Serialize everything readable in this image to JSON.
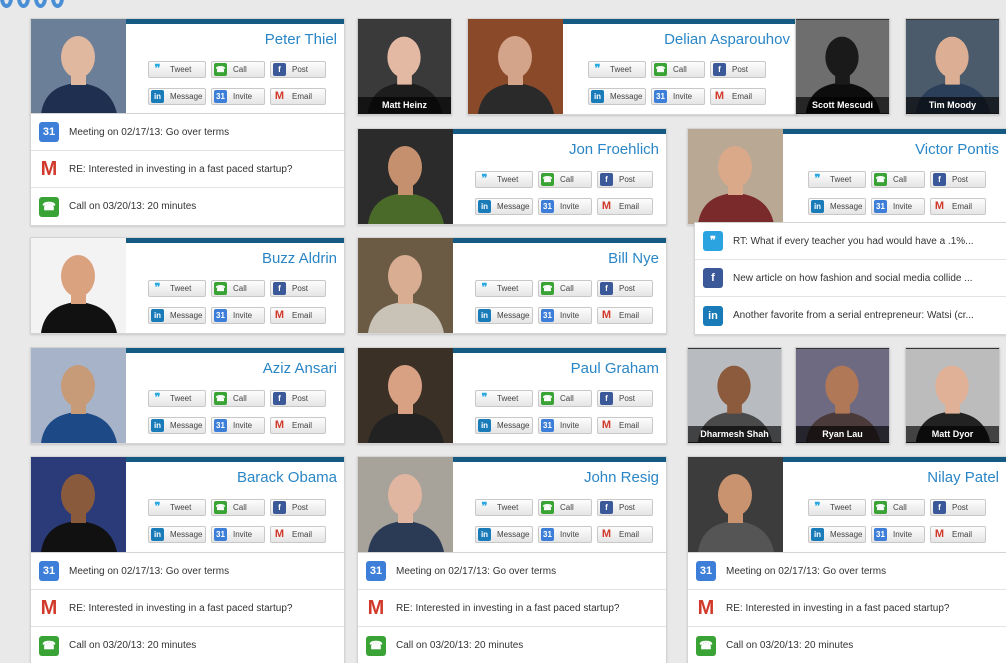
{
  "buttons": {
    "tweet": "Tweet",
    "call": "Call",
    "post": "Post",
    "message": "Message",
    "invite": "Invite",
    "email": "Email"
  },
  "icons": {
    "tweet": "twitter-bird-icon",
    "call": "phone-icon",
    "post": "facebook-icon",
    "message": "linkedin-icon",
    "invite": "calendar-icon",
    "email": "gmail-icon"
  },
  "calendar_glyph": "31",
  "contacts": [
    {
      "name": "Peter Thiel",
      "photo": {
        "bg": "#6b7f99",
        "skin": "#e0b8a0",
        "shirt": "#1f2f4f"
      }
    },
    {
      "name": "Delian Asparouhov",
      "photo": {
        "bg": "#8a4a2a",
        "skin": "#d4a48a",
        "shirt": "#2a2a2a"
      }
    },
    {
      "name": "Jon Froehlich",
      "photo": {
        "bg": "#2b2b2b",
        "skin": "#c4906e",
        "shirt": "#4a6a2a"
      }
    },
    {
      "name": "Victor Pontis",
      "photo": {
        "bg": "#b9a994",
        "skin": "#d9a98a",
        "shirt": "#7a2a2a"
      }
    },
    {
      "name": "Buzz Aldrin",
      "photo": {
        "bg": "#f3f3f3",
        "skin": "#dba27f",
        "shirt": "#111111"
      }
    },
    {
      "name": "Bill Nye",
      "photo": {
        "bg": "#6b5a44",
        "skin": "#d8ad92",
        "shirt": "#c9c2b7"
      }
    },
    {
      "name": "Aziz Ansari",
      "photo": {
        "bg": "#a7b3c9",
        "skin": "#c79a78",
        "shirt": "#1d4a86"
      }
    },
    {
      "name": "Paul Graham",
      "photo": {
        "bg": "#3a3026",
        "skin": "#d8a184",
        "shirt": "#222222"
      }
    },
    {
      "name": "Barack Obama",
      "photo": {
        "bg": "#2b3b7a",
        "skin": "#8a5a3d",
        "shirt": "#111111"
      }
    },
    {
      "name": "John Resig",
      "photo": {
        "bg": "#a7a39b",
        "skin": "#e0b6a0",
        "shirt": "#2b3a55"
      }
    },
    {
      "name": "Nilay Patel",
      "photo": {
        "bg": "#3c3c3c",
        "skin": "#c9936f",
        "shirt": "#555555"
      }
    }
  ],
  "people_tiles": [
    {
      "name": "Matt Heinz",
      "photo": {
        "bg": "#3a3a3a",
        "skin": "#e4b9a4",
        "shirt": "#1d1d1d"
      }
    },
    {
      "name": "Scott Mescudi",
      "photo": {
        "bg": "#6e6e6e",
        "skin": "#1a1a1a",
        "shirt": "#0d0d0d"
      }
    },
    {
      "name": "Tim Moody",
      "photo": {
        "bg": "#4b5b6b",
        "skin": "#dcae93",
        "shirt": "#2b3f5a"
      }
    },
    {
      "name": "Dharmesh Shah",
      "photo": {
        "bg": "#b8bcc0",
        "skin": "#8c5a3c",
        "shirt": "#4a4a4a"
      }
    },
    {
      "name": "Ryan Lau",
      "photo": {
        "bg": "#6d6a82",
        "skin": "#b07856",
        "shirt": "#4a3a3a"
      }
    },
    {
      "name": "Matt Dyor",
      "photo": {
        "bg": "#bcbcbc",
        "skin": "#e0b196",
        "shirt": "#222222"
      }
    }
  ],
  "feed_standard": [
    {
      "icon": "calendar",
      "text": "Meeting on 02/17/13: Go over terms"
    },
    {
      "icon": "gmail",
      "text": "RE: Interested in investing in a fast paced startup?"
    },
    {
      "icon": "phone",
      "text": "Call on 03/20/13: 20 minutes"
    }
  ],
  "feed_social": [
    {
      "icon": "twitter",
      "text": "RT: What if every teacher you had would have a .1%..."
    },
    {
      "icon": "facebook",
      "text": "New article on how fashion and social media collide ..."
    },
    {
      "icon": "linkedin",
      "text": "Another favorite from a serial entrepreneur: Watsi (cr..."
    }
  ]
}
